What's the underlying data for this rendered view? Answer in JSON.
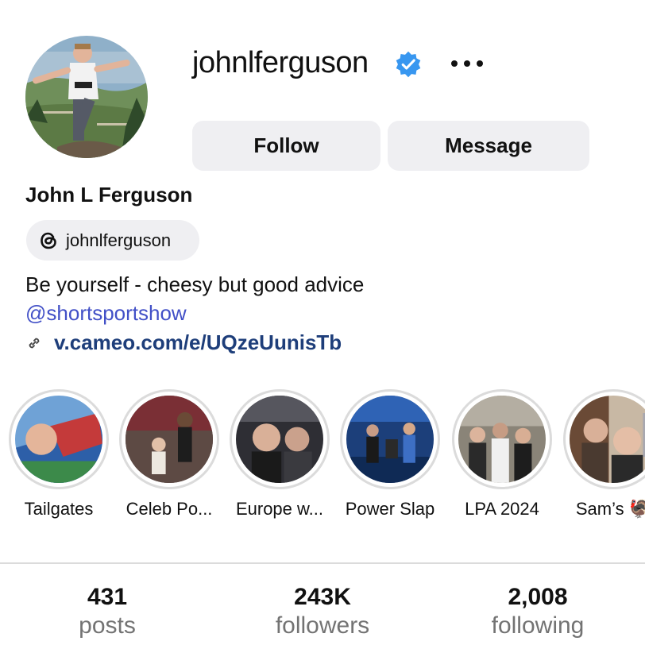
{
  "profile": {
    "username": "johnlferguson",
    "full_name": "John L Ferguson",
    "threads_handle": "johnlferguson",
    "bio": "Be yourself - cheesy but good advice",
    "mention": "@shortsportshow",
    "link": "v.cameo.com/e/UQzeUunisTb",
    "verified_color": "#3897f0"
  },
  "actions": {
    "follow_label": "Follow",
    "message_label": "Message"
  },
  "highlights": [
    {
      "label": "Tailgates"
    },
    {
      "label": "Celeb Po..."
    },
    {
      "label": "Europe w..."
    },
    {
      "label": "Power Slap"
    },
    {
      "label": "LPA 2024"
    },
    {
      "label": "Sam’s 🦃"
    }
  ],
  "stats": {
    "posts": {
      "value": "431",
      "label": "posts"
    },
    "followers": {
      "value": "243K",
      "label": "followers"
    },
    "following": {
      "value": "2,008",
      "label": "following"
    }
  },
  "colors": {
    "button_bg": "#efeff2",
    "mention": "#4250c7",
    "link": "#1e3e7a",
    "muted": "#737373"
  }
}
